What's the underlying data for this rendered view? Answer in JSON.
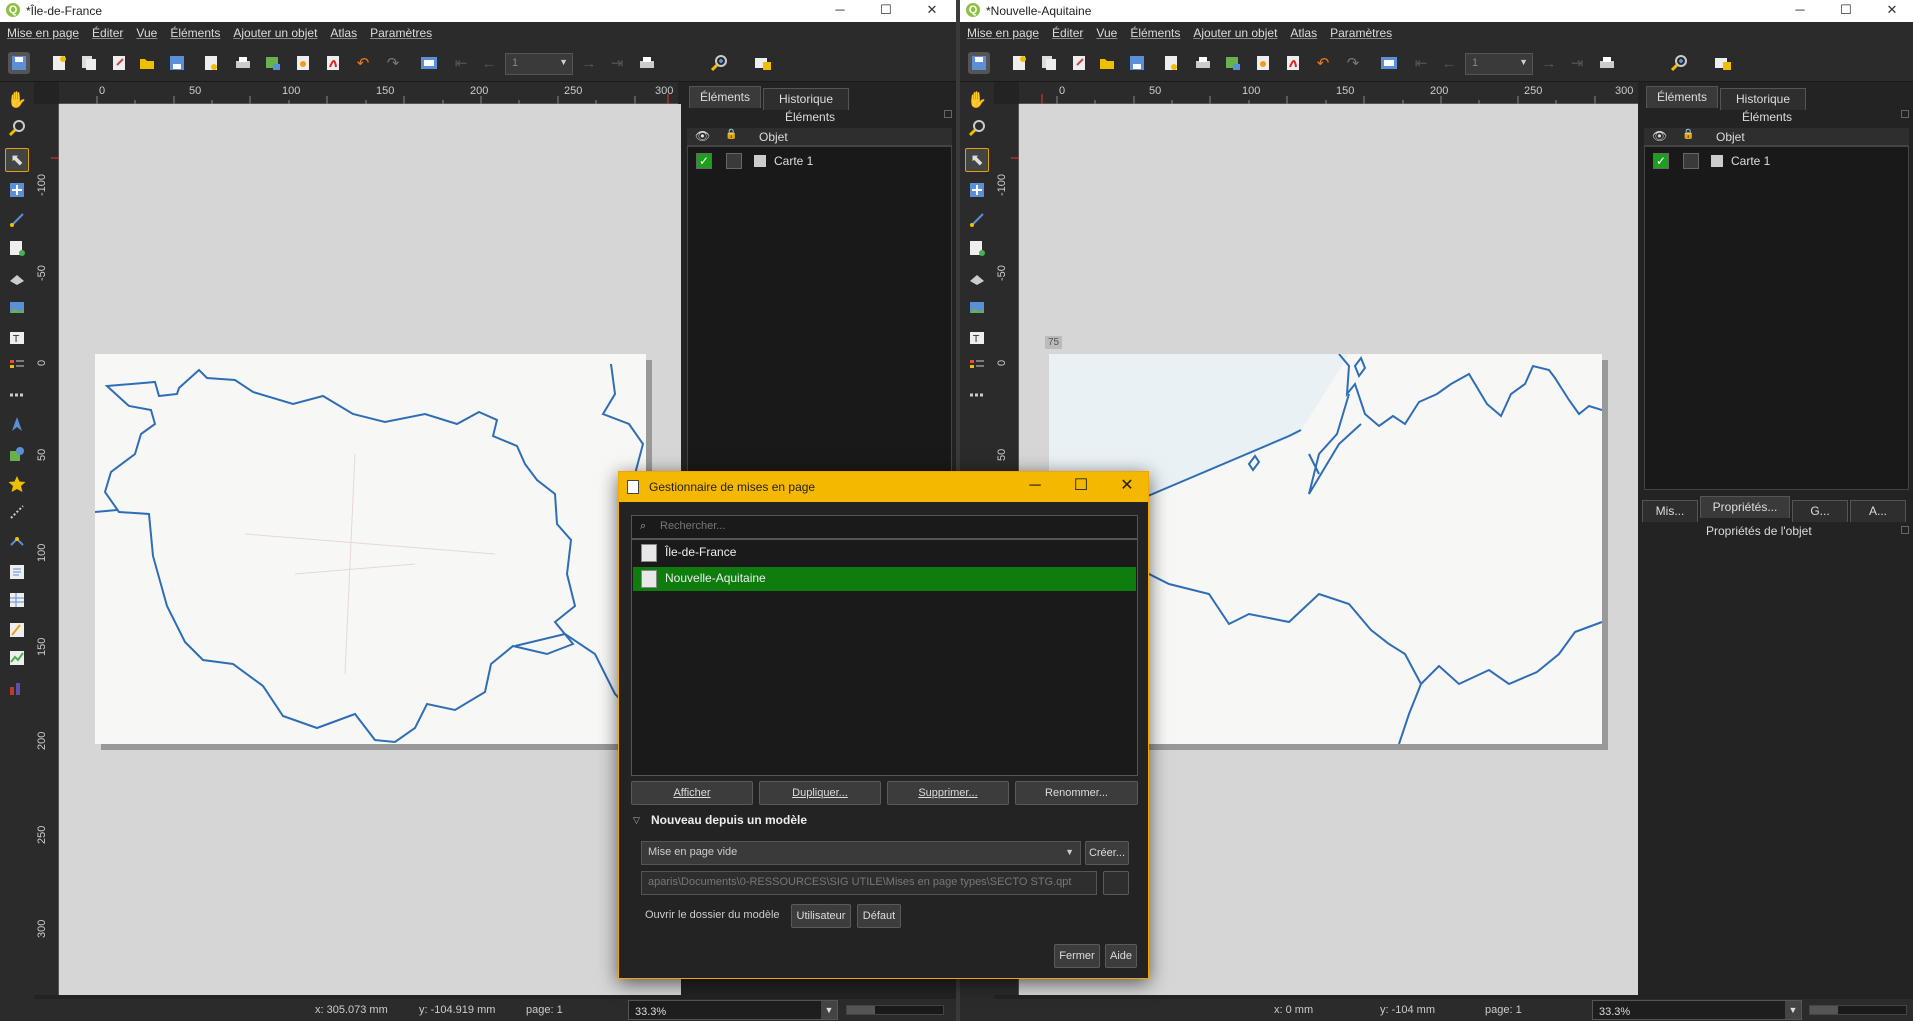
{
  "left_window": {
    "title": "*Île-de-France",
    "menu": [
      "Mise en page",
      "Éditer",
      "Vue",
      "Éléments",
      "Ajouter un objet",
      "Atlas",
      "Paramètres"
    ],
    "page_selector": "1",
    "ruler_h": [
      "0",
      "50",
      "100",
      "150",
      "200",
      "250",
      "300"
    ],
    "ruler_v": [
      "-100",
      "-50",
      "0",
      "50",
      "100",
      "150",
      "200",
      "250",
      "300"
    ],
    "panel": {
      "tabs": [
        "Éléments",
        "Historique"
      ],
      "title": "Éléments",
      "col_object": "Objet",
      "items": [
        {
          "label": "Carte 1",
          "visible": true
        }
      ]
    },
    "status": {
      "x": "x: 305.073 mm",
      "y": "y: -104.919 mm",
      "page": "page: 1",
      "zoom": "33.3%",
      "zoom_slider": 0.3
    }
  },
  "right_window": {
    "title": "*Nouvelle-Aquitaine",
    "menu": [
      "Mise en page",
      "Éditer",
      "Vue",
      "Éléments",
      "Ajouter un objet",
      "Atlas",
      "Paramètres"
    ],
    "page_selector": "1",
    "ruler_h": [
      "0",
      "50",
      "100",
      "150",
      "200",
      "250",
      "300"
    ],
    "ruler_v": [
      "-100",
      "-50",
      "0",
      "50"
    ],
    "page_badge": "75",
    "panel": {
      "tabs": [
        "Éléments",
        "Historique"
      ],
      "title": "Éléments",
      "col_object": "Objet",
      "items": [
        {
          "label": "Carte 1",
          "visible": true
        }
      ],
      "bottom_tabs": [
        "Mis...",
        "Propriétés...",
        "G...",
        "A..."
      ],
      "bottom_title": "Propriétés de l'objet"
    },
    "status": {
      "x": "x: 0 mm",
      "y": "y: -104 mm",
      "page": "page: 1",
      "zoom": "33.3%",
      "zoom_slider": 0.3
    }
  },
  "dialog": {
    "title": "Gestionnaire de mises en page",
    "search_placeholder": "Rechercher...",
    "layouts": [
      "Île-de-France",
      "Nouvelle-Aquitaine"
    ],
    "selected_index": 1,
    "buttons": {
      "show": "Afficher",
      "duplicate": "Dupliquer...",
      "remove": "Supprimer...",
      "rename": "Renommer..."
    },
    "section_title": "Nouveau depuis un modèle",
    "template_select": "Mise en page vide",
    "create": "Créer...",
    "path": "aparis\\Documents\\0-RESSOURCES\\SIG UTILE\\Mises en page types\\SECTO STG.qpt",
    "open_folder_label": "Ouvrir le dossier du modèle",
    "user": "Utilisateur",
    "default": "Défaut",
    "close": "Fermer",
    "help": "Aide"
  },
  "colors": {
    "selection": "#0e7d0e",
    "dialog_title": "#f5b800",
    "boundary": "#2f6db5"
  }
}
